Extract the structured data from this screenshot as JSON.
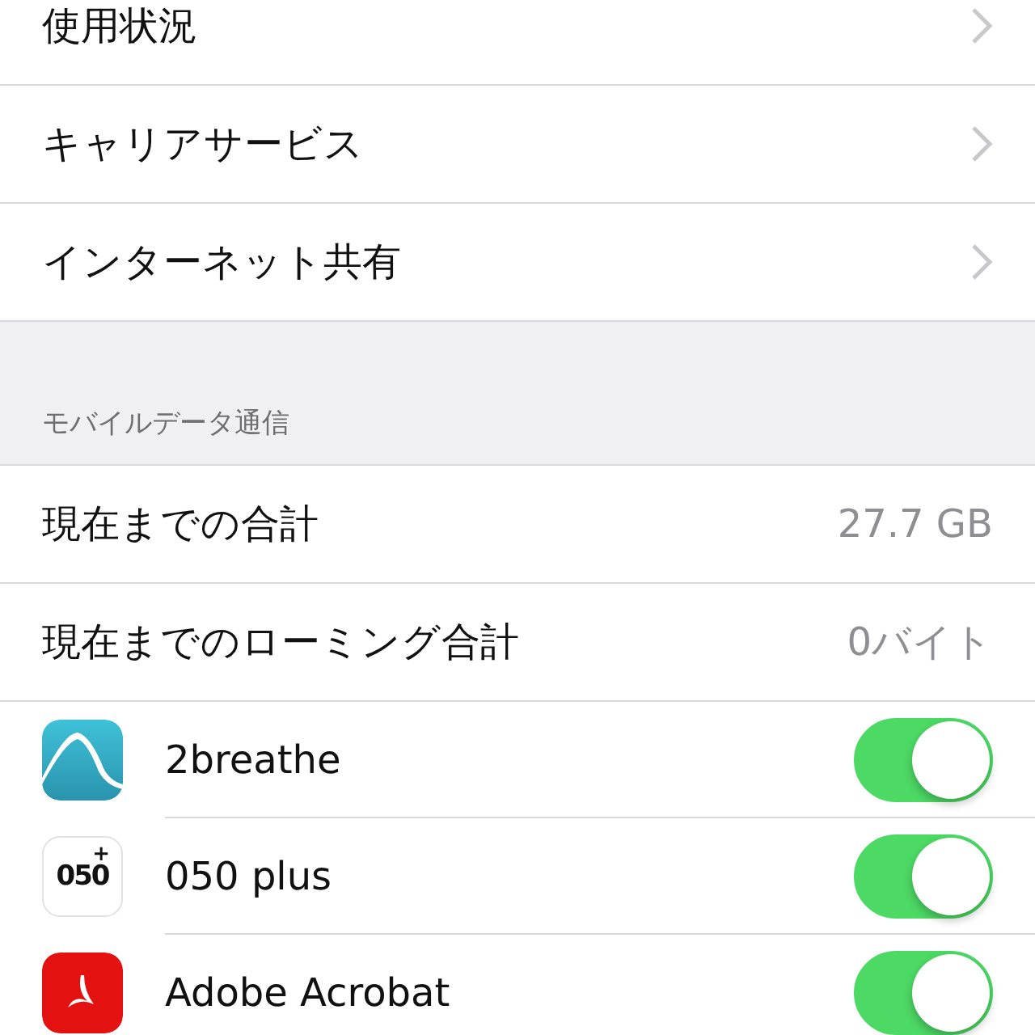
{
  "menu_rows": [
    {
      "label": "使用状況"
    },
    {
      "label": "キャリアサービス"
    },
    {
      "label": "インターネット共有"
    }
  ],
  "section_header": "モバイルデータ通信",
  "totals": [
    {
      "label": "現在までの合計",
      "value": "27.7 GB"
    },
    {
      "label": "現在までのローミング合計",
      "value": "0バイト"
    }
  ],
  "apps": [
    {
      "name": "2breathe",
      "on": true
    },
    {
      "name": "050 plus",
      "on": true,
      "icon_text": "050",
      "icon_mark": "+"
    },
    {
      "name": "Adobe Acrobat",
      "on": true
    }
  ]
}
